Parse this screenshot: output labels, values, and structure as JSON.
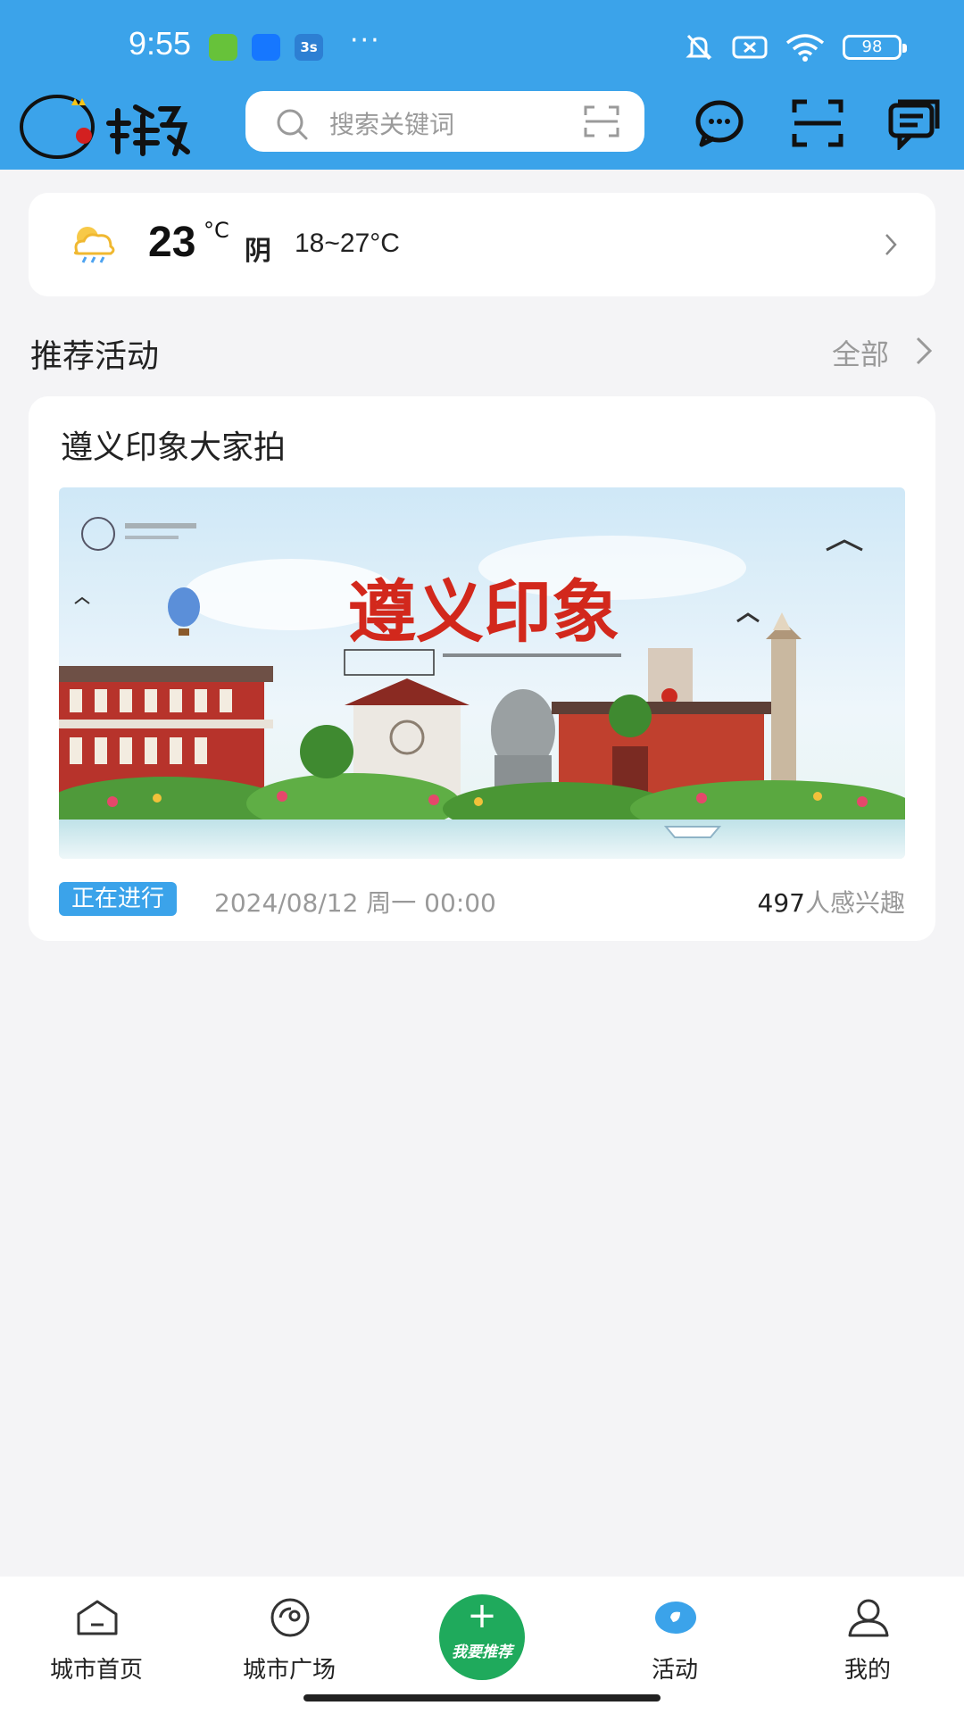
{
  "status_bar": {
    "time": "9:55",
    "notification_badge": "3s",
    "more": "···",
    "battery": "98"
  },
  "header": {
    "logo_text": "推荐",
    "search_placeholder": "搜索关键词"
  },
  "weather": {
    "temperature": "23",
    "unit": "°C",
    "condition": "阴",
    "range": "18~27°C"
  },
  "section": {
    "title": "推荐活动",
    "more_label": "全部"
  },
  "activity": {
    "title": "遵义印象大家拍",
    "banner_text": "遵义印象",
    "status": "正在进行",
    "date": "2024/08/12 周一 00:00",
    "interest_count": "497",
    "interest_suffix": "人感兴趣"
  },
  "bottom_nav": {
    "items": [
      {
        "label": "城市首页"
      },
      {
        "label": "城市广场"
      },
      {
        "label": "我要推荐"
      },
      {
        "label": "活动"
      },
      {
        "label": "我的"
      }
    ],
    "post_plus": "+"
  },
  "colors": {
    "brand": "#3ba3ea",
    "post_button": "#1faa5c"
  }
}
